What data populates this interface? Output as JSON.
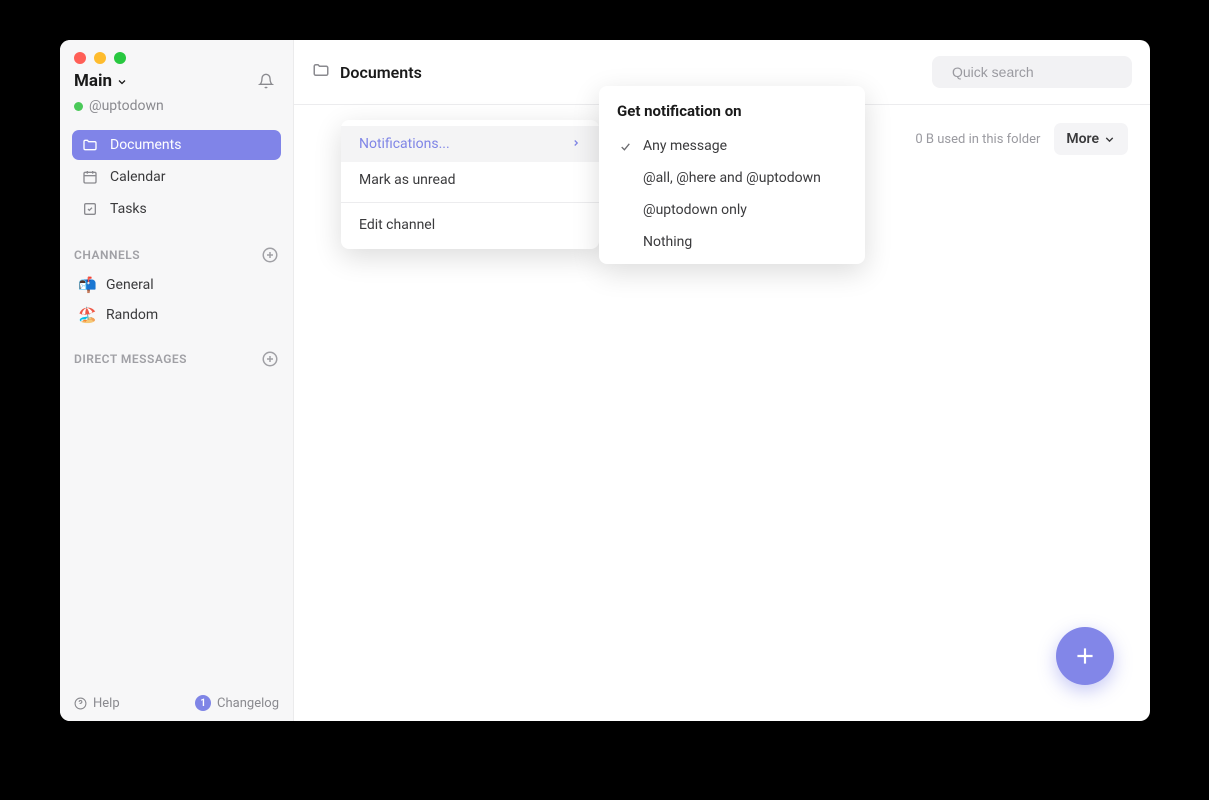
{
  "workspace": {
    "name": "Main",
    "username": "@uptodown"
  },
  "sidebar": {
    "nav": [
      {
        "label": "Documents",
        "icon": "folder-icon"
      },
      {
        "label": "Calendar",
        "icon": "calendar-icon"
      },
      {
        "label": "Tasks",
        "icon": "task-icon"
      }
    ],
    "channels_header": "CHANNELS",
    "channels": [
      {
        "emoji": "📬",
        "label": "General"
      },
      {
        "emoji": "🏖️",
        "label": "Random"
      }
    ],
    "dm_header": "DIRECT MESSAGES"
  },
  "footer": {
    "help": "Help",
    "changelog": "Changelog",
    "changelog_count": "1"
  },
  "topbar": {
    "breadcrumb": "Documents",
    "search_placeholder": "Quick search"
  },
  "folder": {
    "usage": "0 B used in this folder",
    "more": "More"
  },
  "context_menu": {
    "items": [
      {
        "label": "Notifications...",
        "highlight": true,
        "has_submenu": true
      },
      {
        "label": "Mark as unread"
      }
    ],
    "edit_channel": "Edit channel"
  },
  "submenu": {
    "title": "Get notification on",
    "options": [
      {
        "label": "Any message",
        "checked": true
      },
      {
        "label": "@all, @here and @uptodown",
        "checked": false
      },
      {
        "label": "@uptodown only",
        "checked": false
      },
      {
        "label": "Nothing",
        "checked": false
      }
    ]
  }
}
